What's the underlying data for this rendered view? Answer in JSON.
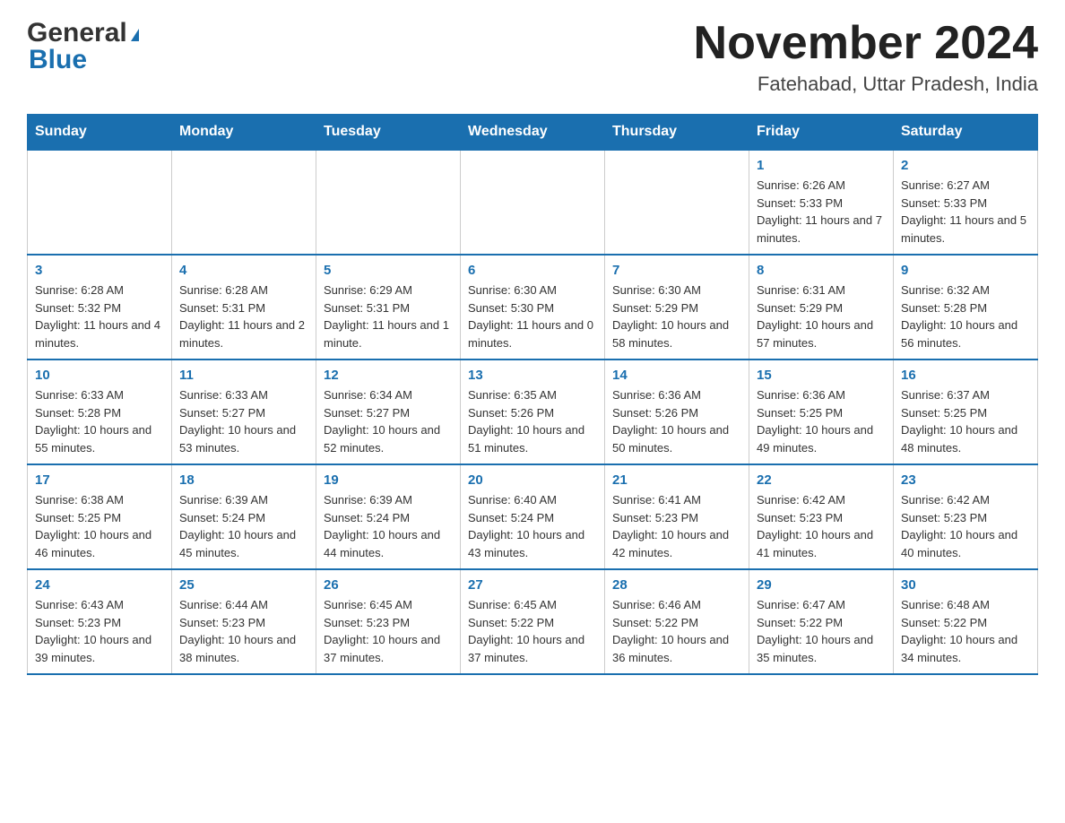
{
  "header": {
    "logo": {
      "general": "General",
      "blue": "Blue",
      "triangle": "▶"
    },
    "title": "November 2024",
    "location": "Fatehabad, Uttar Pradesh, India"
  },
  "weekdays": [
    "Sunday",
    "Monday",
    "Tuesday",
    "Wednesday",
    "Thursday",
    "Friday",
    "Saturday"
  ],
  "rows": [
    {
      "cells": [
        {
          "day": "",
          "info": ""
        },
        {
          "day": "",
          "info": ""
        },
        {
          "day": "",
          "info": ""
        },
        {
          "day": "",
          "info": ""
        },
        {
          "day": "",
          "info": ""
        },
        {
          "day": "1",
          "info": "Sunrise: 6:26 AM\nSunset: 5:33 PM\nDaylight: 11 hours and 7 minutes."
        },
        {
          "day": "2",
          "info": "Sunrise: 6:27 AM\nSunset: 5:33 PM\nDaylight: 11 hours and 5 minutes."
        }
      ]
    },
    {
      "cells": [
        {
          "day": "3",
          "info": "Sunrise: 6:28 AM\nSunset: 5:32 PM\nDaylight: 11 hours and 4 minutes."
        },
        {
          "day": "4",
          "info": "Sunrise: 6:28 AM\nSunset: 5:31 PM\nDaylight: 11 hours and 2 minutes."
        },
        {
          "day": "5",
          "info": "Sunrise: 6:29 AM\nSunset: 5:31 PM\nDaylight: 11 hours and 1 minute."
        },
        {
          "day": "6",
          "info": "Sunrise: 6:30 AM\nSunset: 5:30 PM\nDaylight: 11 hours and 0 minutes."
        },
        {
          "day": "7",
          "info": "Sunrise: 6:30 AM\nSunset: 5:29 PM\nDaylight: 10 hours and 58 minutes."
        },
        {
          "day": "8",
          "info": "Sunrise: 6:31 AM\nSunset: 5:29 PM\nDaylight: 10 hours and 57 minutes."
        },
        {
          "day": "9",
          "info": "Sunrise: 6:32 AM\nSunset: 5:28 PM\nDaylight: 10 hours and 56 minutes."
        }
      ]
    },
    {
      "cells": [
        {
          "day": "10",
          "info": "Sunrise: 6:33 AM\nSunset: 5:28 PM\nDaylight: 10 hours and 55 minutes."
        },
        {
          "day": "11",
          "info": "Sunrise: 6:33 AM\nSunset: 5:27 PM\nDaylight: 10 hours and 53 minutes."
        },
        {
          "day": "12",
          "info": "Sunrise: 6:34 AM\nSunset: 5:27 PM\nDaylight: 10 hours and 52 minutes."
        },
        {
          "day": "13",
          "info": "Sunrise: 6:35 AM\nSunset: 5:26 PM\nDaylight: 10 hours and 51 minutes."
        },
        {
          "day": "14",
          "info": "Sunrise: 6:36 AM\nSunset: 5:26 PM\nDaylight: 10 hours and 50 minutes."
        },
        {
          "day": "15",
          "info": "Sunrise: 6:36 AM\nSunset: 5:25 PM\nDaylight: 10 hours and 49 minutes."
        },
        {
          "day": "16",
          "info": "Sunrise: 6:37 AM\nSunset: 5:25 PM\nDaylight: 10 hours and 48 minutes."
        }
      ]
    },
    {
      "cells": [
        {
          "day": "17",
          "info": "Sunrise: 6:38 AM\nSunset: 5:25 PM\nDaylight: 10 hours and 46 minutes."
        },
        {
          "day": "18",
          "info": "Sunrise: 6:39 AM\nSunset: 5:24 PM\nDaylight: 10 hours and 45 minutes."
        },
        {
          "day": "19",
          "info": "Sunrise: 6:39 AM\nSunset: 5:24 PM\nDaylight: 10 hours and 44 minutes."
        },
        {
          "day": "20",
          "info": "Sunrise: 6:40 AM\nSunset: 5:24 PM\nDaylight: 10 hours and 43 minutes."
        },
        {
          "day": "21",
          "info": "Sunrise: 6:41 AM\nSunset: 5:23 PM\nDaylight: 10 hours and 42 minutes."
        },
        {
          "day": "22",
          "info": "Sunrise: 6:42 AM\nSunset: 5:23 PM\nDaylight: 10 hours and 41 minutes."
        },
        {
          "day": "23",
          "info": "Sunrise: 6:42 AM\nSunset: 5:23 PM\nDaylight: 10 hours and 40 minutes."
        }
      ]
    },
    {
      "cells": [
        {
          "day": "24",
          "info": "Sunrise: 6:43 AM\nSunset: 5:23 PM\nDaylight: 10 hours and 39 minutes."
        },
        {
          "day": "25",
          "info": "Sunrise: 6:44 AM\nSunset: 5:23 PM\nDaylight: 10 hours and 38 minutes."
        },
        {
          "day": "26",
          "info": "Sunrise: 6:45 AM\nSunset: 5:23 PM\nDaylight: 10 hours and 37 minutes."
        },
        {
          "day": "27",
          "info": "Sunrise: 6:45 AM\nSunset: 5:22 PM\nDaylight: 10 hours and 37 minutes."
        },
        {
          "day": "28",
          "info": "Sunrise: 6:46 AM\nSunset: 5:22 PM\nDaylight: 10 hours and 36 minutes."
        },
        {
          "day": "29",
          "info": "Sunrise: 6:47 AM\nSunset: 5:22 PM\nDaylight: 10 hours and 35 minutes."
        },
        {
          "day": "30",
          "info": "Sunrise: 6:48 AM\nSunset: 5:22 PM\nDaylight: 10 hours and 34 minutes."
        }
      ]
    }
  ]
}
